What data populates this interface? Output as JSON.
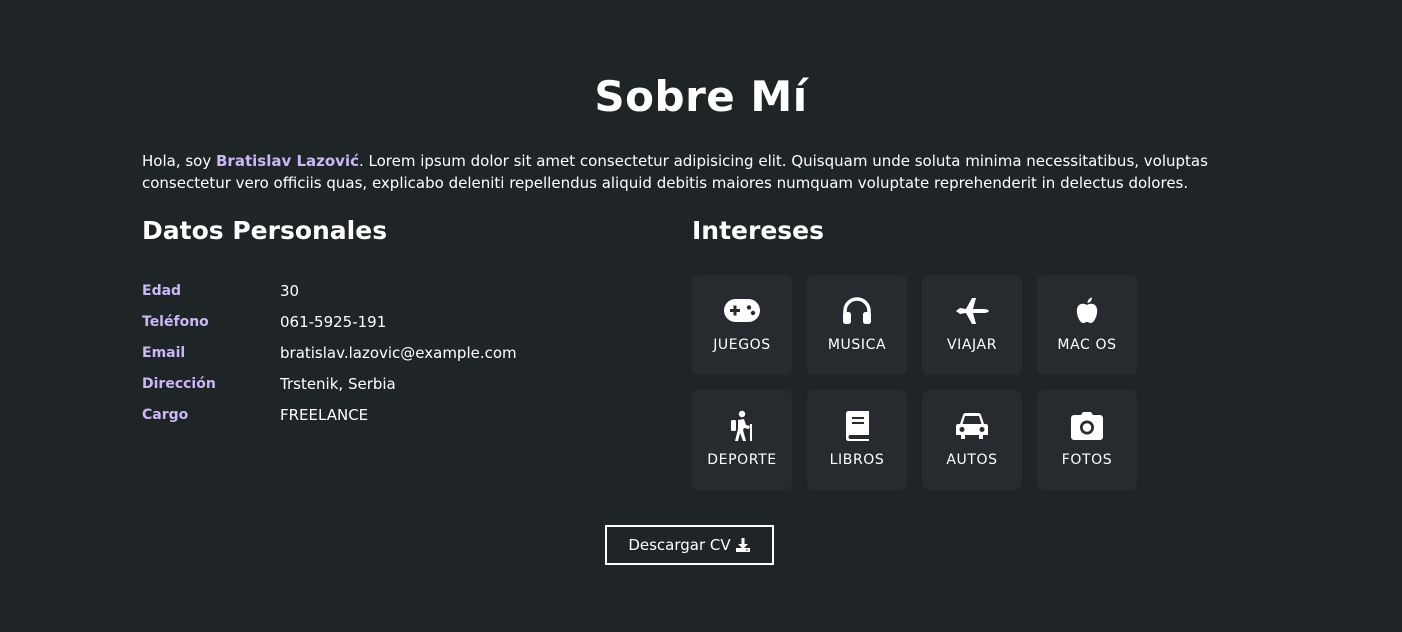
{
  "about": {
    "title": "Sobre Mí",
    "intro_prefix": "Hola, soy ",
    "intro_name": "Bratislav Lazović",
    "intro_suffix": ". Lorem ipsum dolor sit amet consectetur adipisicing elit. Quisquam unde soluta minima necessitatibus, voluptas consectetur vero officiis quas, explicabo deleniti repellendus aliquid debitis maiores numquam voluptate reprehenderit in delectus dolores."
  },
  "personal": {
    "heading": "Datos Personales",
    "rows": [
      {
        "key": "Edad",
        "value": "30"
      },
      {
        "key": "Teléfono",
        "value": "061-5925-191"
      },
      {
        "key": "Email",
        "value": "bratislav.lazovic@example.com"
      },
      {
        "key": "Dirección",
        "value": "Trstenik, Serbia"
      },
      {
        "key": "Cargo",
        "value": "FREELANCE"
      }
    ]
  },
  "interests": {
    "heading": "Intereses",
    "items": [
      {
        "label": "JUEGOS",
        "icon": "gamepad-icon"
      },
      {
        "label": "MUSICA",
        "icon": "headphones-icon"
      },
      {
        "label": "VIAJAR",
        "icon": "plane-icon"
      },
      {
        "label": "MAC OS",
        "icon": "apple-icon"
      },
      {
        "label": "DEPORTE",
        "icon": "hiking-icon"
      },
      {
        "label": "LIBROS",
        "icon": "book-icon"
      },
      {
        "label": "AUTOS",
        "icon": "car-icon"
      },
      {
        "label": "FOTOS",
        "icon": "camera-icon"
      }
    ]
  },
  "cv_button": {
    "label": "Descargar CV",
    "icon": "download-icon"
  },
  "colors": {
    "background": "#1f2427",
    "tile": "#272b30",
    "accent": "#c9b8f5",
    "text": "#ffffff"
  }
}
